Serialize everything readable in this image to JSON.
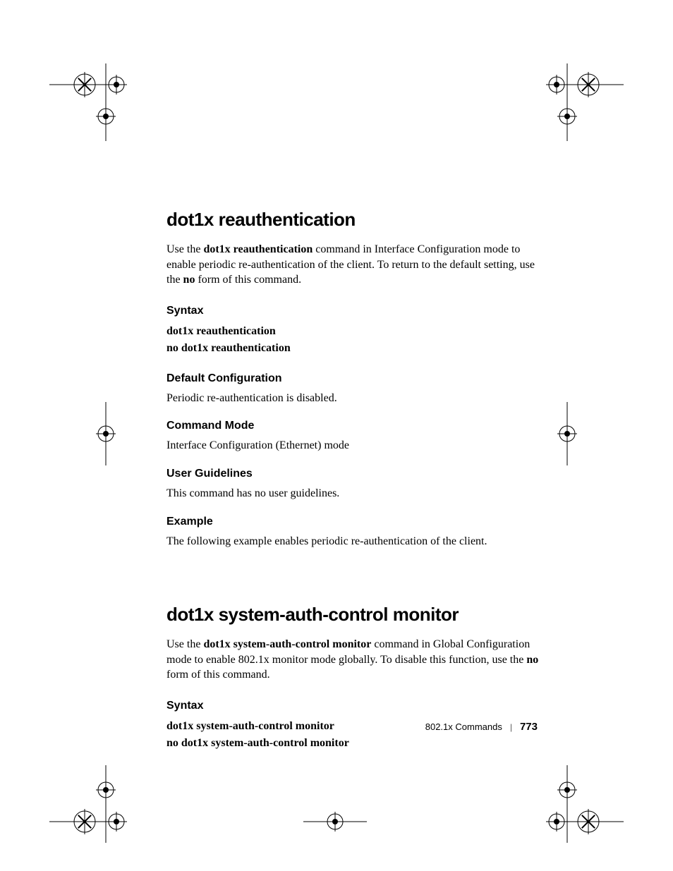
{
  "section1": {
    "title": "dot1x reauthentication",
    "intro_prefix": "Use the ",
    "intro_cmd": "dot1x reauthentication",
    "intro_mid": " command in Interface Configuration mode to enable periodic re-authentication of the client. To return to the default setting, use the ",
    "intro_no": "no",
    "intro_suffix": " form of this command.",
    "syntax_heading": "Syntax",
    "syntax_line1": "dot1x reauthentication",
    "syntax_line2": "no dot1x reauthentication",
    "default_heading": "Default Configuration",
    "default_text": "Periodic re-authentication is disabled.",
    "mode_heading": "Command Mode",
    "mode_text": "Interface Configuration (Ethernet) mode",
    "guidelines_heading": "User Guidelines",
    "guidelines_text": "This command has no user guidelines.",
    "example_heading": "Example",
    "example_text": "The following example enables periodic re-authentication of the client."
  },
  "section2": {
    "title": "dot1x system-auth-control monitor",
    "intro_prefix": "Use the ",
    "intro_cmd": "dot1x system-auth-control monitor",
    "intro_mid": " command in Global Configuration mode to enable 802.1x monitor mode globally. To disable this function, use the ",
    "intro_no": "no",
    "intro_suffix": " form of this command.",
    "syntax_heading": "Syntax",
    "syntax_line1": "dot1x system-auth-control monitor",
    "syntax_line2": "no dot1x system-auth-control monitor"
  },
  "footer": {
    "label": "802.1x Commands",
    "page": "773"
  }
}
